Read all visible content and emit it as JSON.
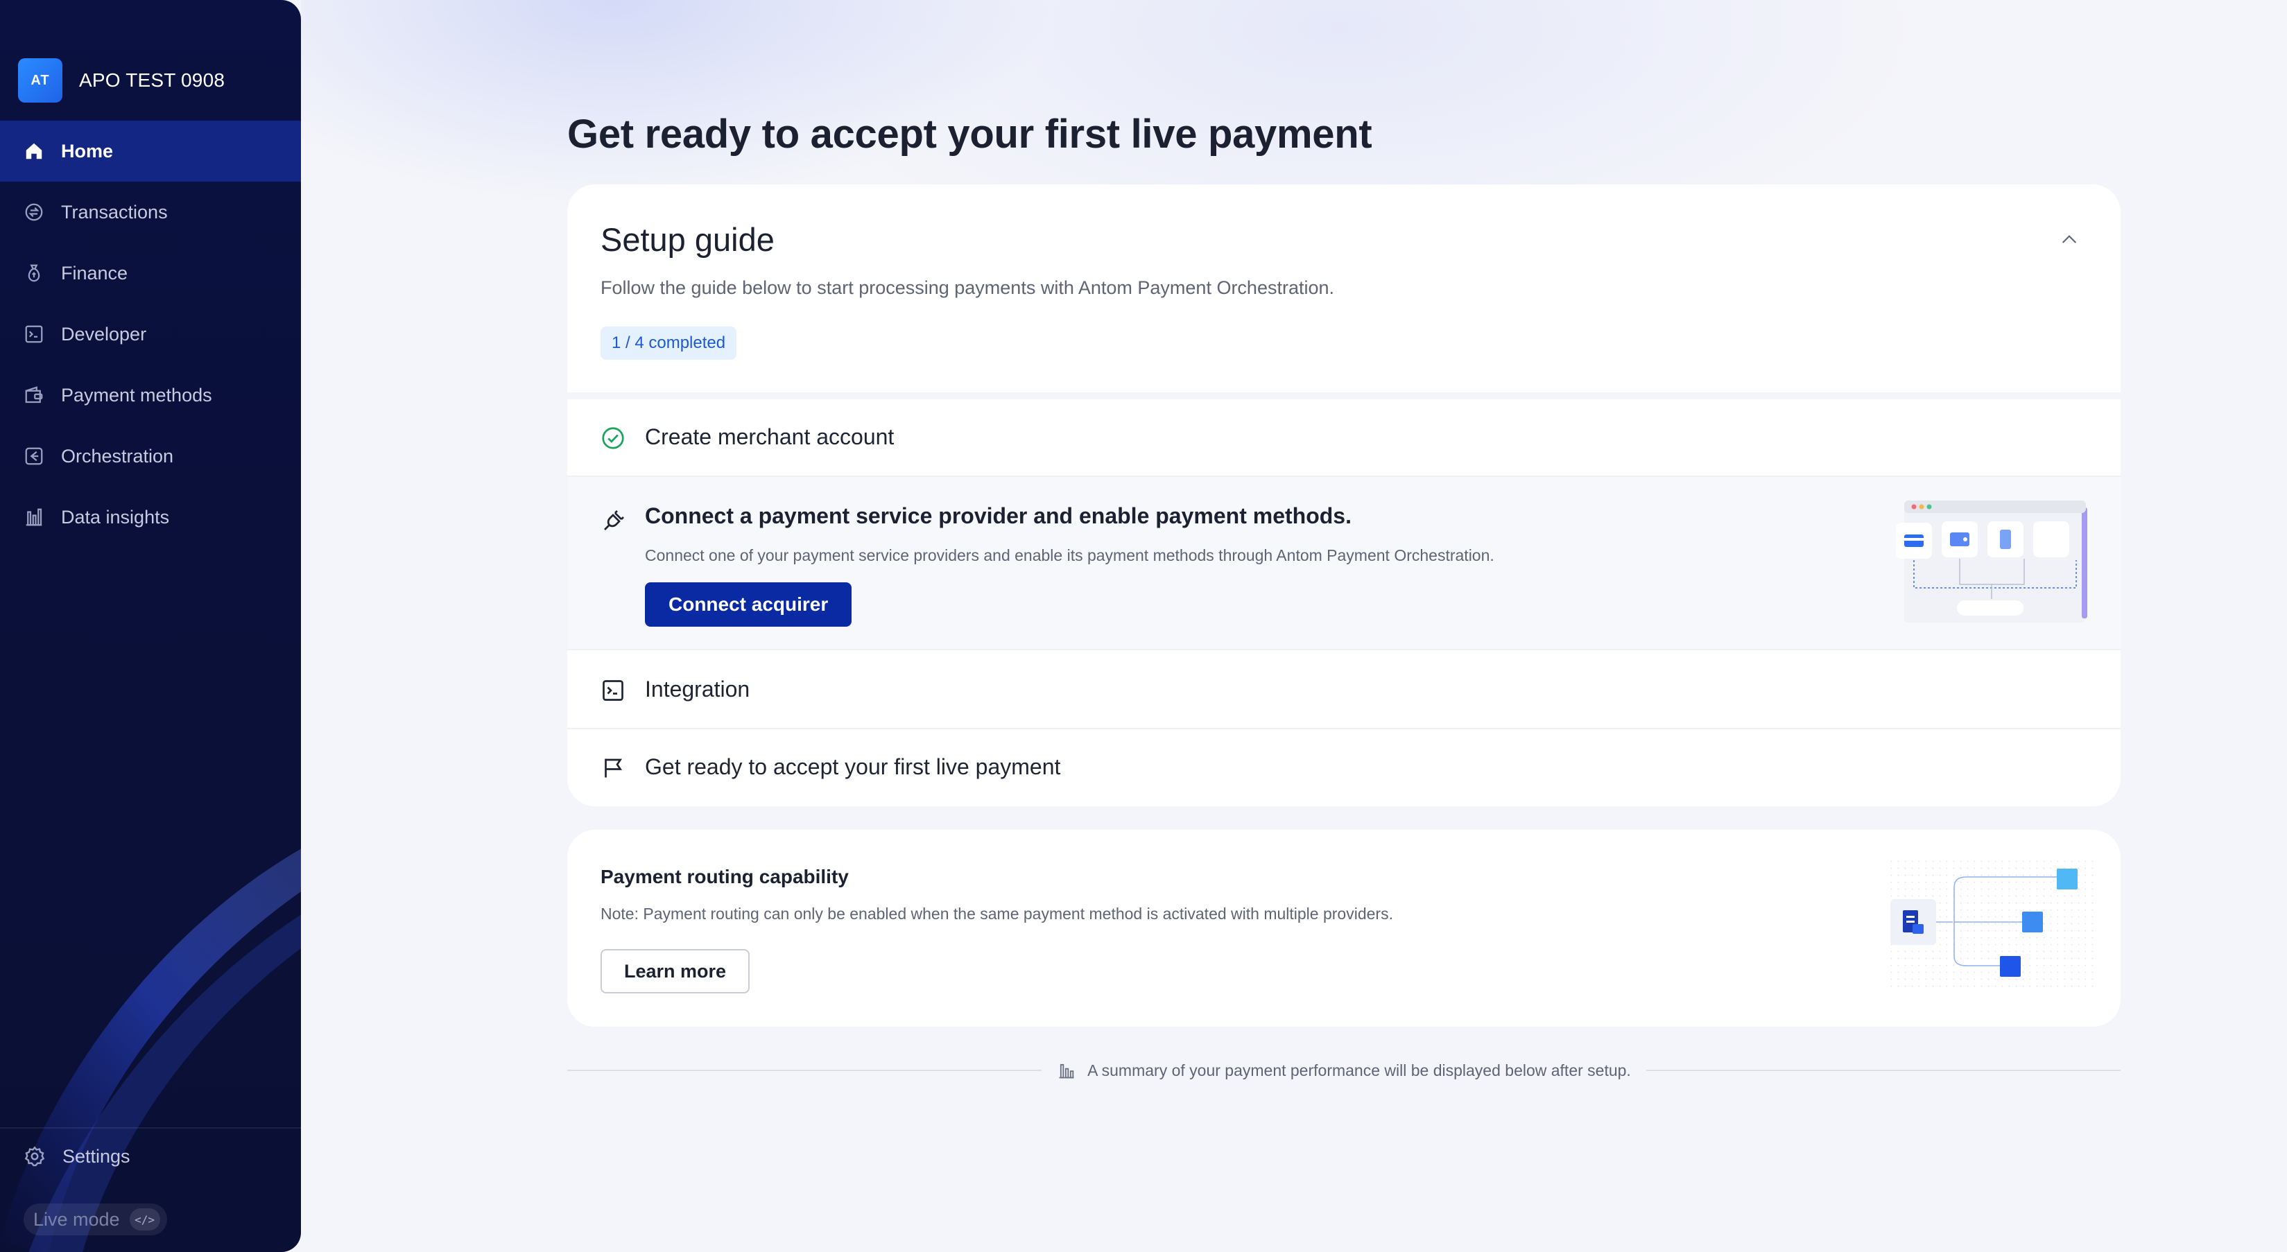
{
  "sidebar": {
    "org_initials": "AT",
    "org_name": "APO TEST 0908",
    "nav": [
      {
        "label": "Home",
        "icon": "home-icon",
        "active": true
      },
      {
        "label": "Transactions",
        "icon": "transactions-icon"
      },
      {
        "label": "Finance",
        "icon": "finance-icon"
      },
      {
        "label": "Developer",
        "icon": "developer-icon"
      },
      {
        "label": "Payment methods",
        "icon": "wallet-icon"
      },
      {
        "label": "Orchestration",
        "icon": "orchestration-icon"
      },
      {
        "label": "Data insights",
        "icon": "chart-icon"
      }
    ],
    "settings_label": "Settings",
    "mode_label": "Live mode",
    "mode_toggle_glyph": "</>"
  },
  "main": {
    "title": "Get ready to accept your first live payment",
    "setup_guide": {
      "title": "Setup guide",
      "description": "Follow the guide below to start processing payments with Antom Payment Orchestration.",
      "progress": "1 / 4 completed",
      "steps": [
        {
          "title": "Create merchant account",
          "status": "completed"
        },
        {
          "title": "Connect a payment service provider and enable payment methods.",
          "description": "Connect one of your payment service providers and enable its payment methods through Antom Payment Orchestration.",
          "button_label": "Connect acquirer",
          "status": "current"
        },
        {
          "title": "Integration",
          "status": "pending"
        },
        {
          "title": "Get ready to accept your first live payment",
          "status": "pending"
        }
      ]
    },
    "routing": {
      "title": "Payment routing capability",
      "note": "Note: Payment routing can only be enabled when the same payment method is activated with multiple providers.",
      "button_label": "Learn more"
    },
    "summary_note": "A summary of your payment performance will be displayed below after setup."
  },
  "colors": {
    "sidebar_bg": "#0b1140",
    "sidebar_active": "#142684",
    "primary_button": "#0a2aa4",
    "success": "#1aa35a",
    "badge_bg": "#e6f1ff",
    "badge_text": "#1a5ad6"
  }
}
